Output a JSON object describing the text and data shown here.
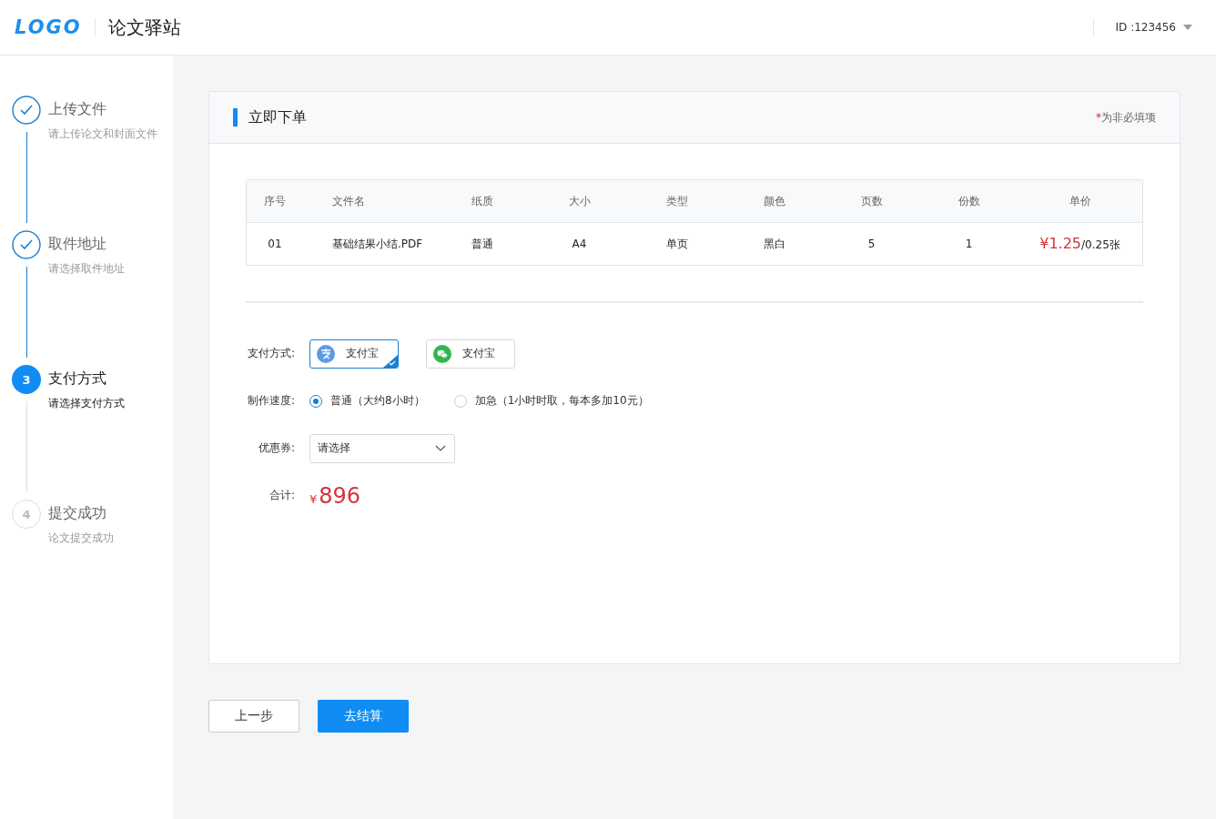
{
  "header": {
    "logo": "LOGO",
    "site_title": "论文驿站",
    "user_id": "ID :123456"
  },
  "steps": [
    {
      "title": "上传文件",
      "subtitle": "请上传论文和封面文件",
      "kind": "done"
    },
    {
      "title": "取件地址",
      "subtitle": "请选择取件地址",
      "kind": "done"
    },
    {
      "number": "3",
      "title": "支付方式",
      "subtitle": "请选择支付方式",
      "kind": "active"
    },
    {
      "number": "4",
      "title": "提交成功",
      "subtitle": "论文提交成功",
      "kind": "todo"
    }
  ],
  "card": {
    "title": "立即下单",
    "note_mark": "*",
    "note": "为非必填项"
  },
  "table": {
    "columns": [
      "序号",
      "文件名",
      "纸质",
      "大小",
      "类型",
      "颜色",
      "页数",
      "份数",
      "单价"
    ],
    "rows": [
      {
        "cells": [
          "01",
          "基础结果小结.PDF",
          "普通",
          "A4",
          "单页",
          "黑白",
          "5",
          "1"
        ],
        "price": "¥1.25",
        "price_unit": "/0.25张"
      }
    ]
  },
  "payment": {
    "label": "支付方式:",
    "options": [
      {
        "kind": "alipay",
        "label": "支付宝",
        "selected": true
      },
      {
        "kind": "wechat",
        "label": "支付宝",
        "selected": false
      }
    ]
  },
  "speed": {
    "label": "制作速度:",
    "options": [
      {
        "label": "普通（大约8小时）",
        "selected": true
      },
      {
        "label": "加急（1小时时取，每本多加10元）",
        "selected": false
      }
    ]
  },
  "coupon": {
    "label": "优惠券:",
    "placeholder": "请选择"
  },
  "total": {
    "label": "合计:",
    "currency": "¥",
    "amount": "896"
  },
  "buttons": {
    "back": "上一步",
    "checkout": "去结算"
  }
}
